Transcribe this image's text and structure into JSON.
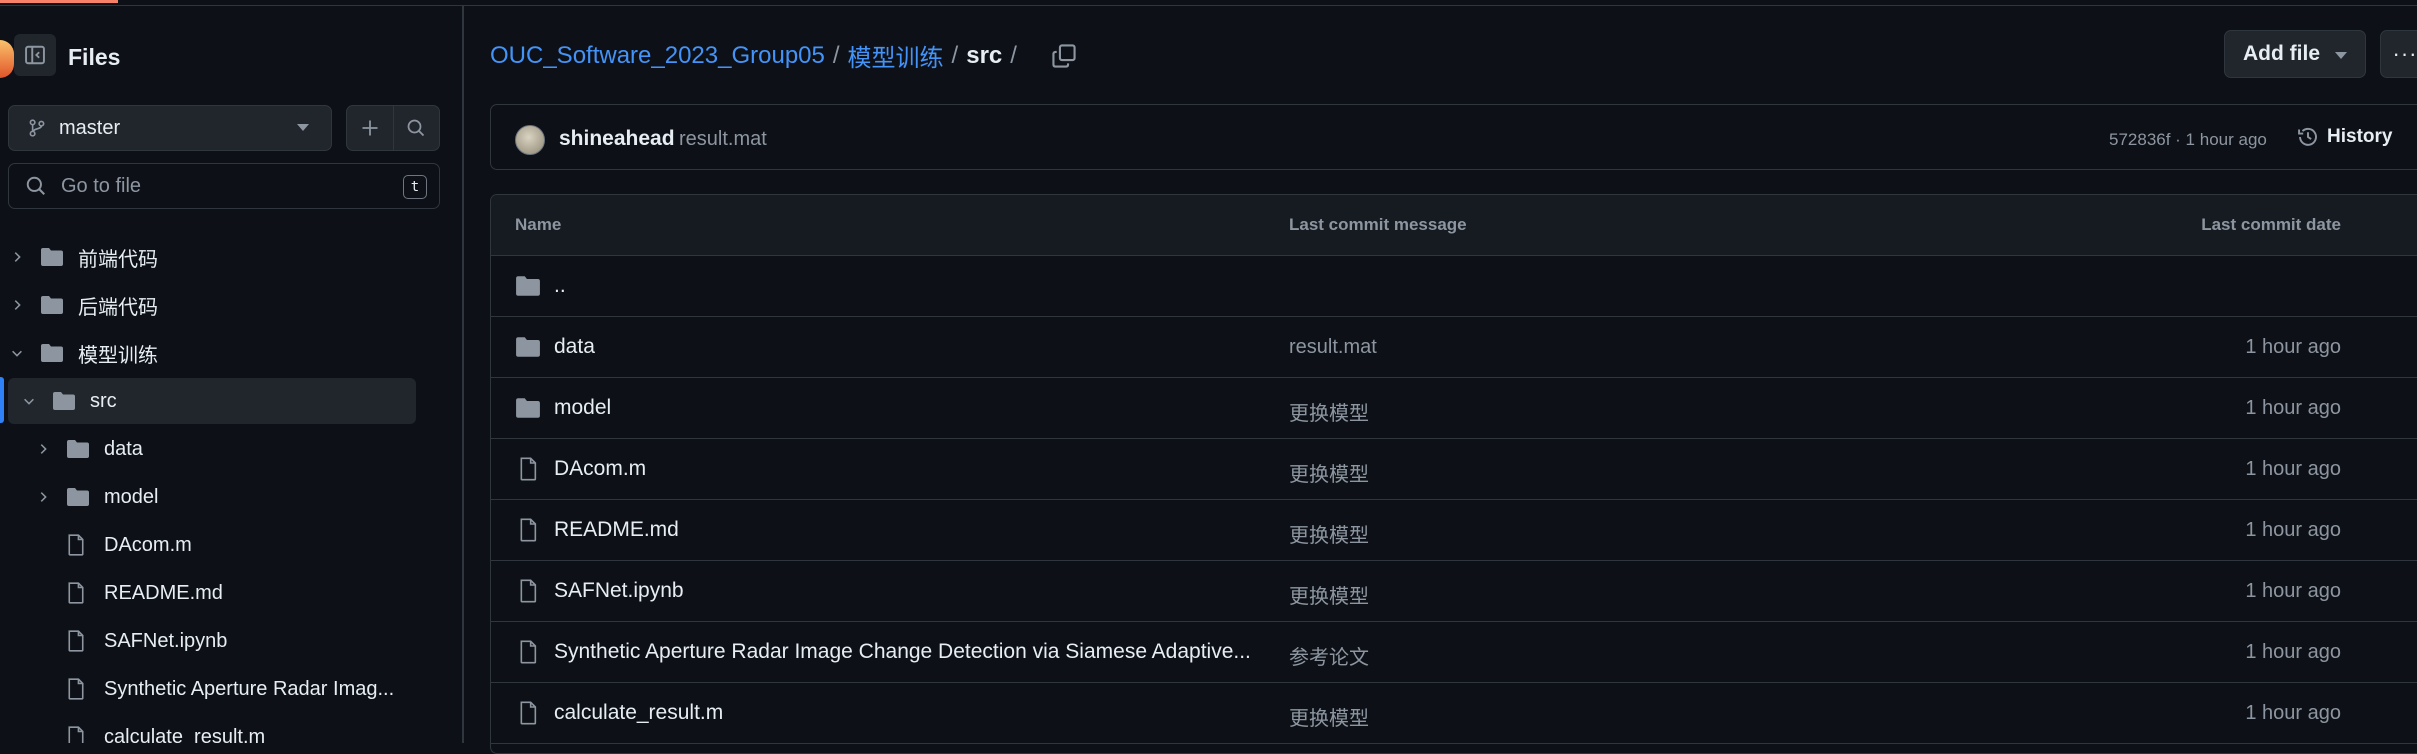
{
  "sidebar": {
    "title": "Files",
    "branch": "master",
    "goto_placeholder": "Go to file",
    "goto_shortcut": "t",
    "tree": [
      {
        "label": "前端代码",
        "type": "folder",
        "expanded": false
      },
      {
        "label": "后端代码",
        "type": "folder",
        "expanded": false
      },
      {
        "label": "模型训练",
        "type": "folder",
        "expanded": true
      },
      {
        "label": "src",
        "type": "folder",
        "expanded": true,
        "selected": true
      },
      {
        "label": "data",
        "type": "folder",
        "expanded": false
      },
      {
        "label": "model",
        "type": "folder",
        "expanded": false
      },
      {
        "label": "DAcom.m",
        "type": "file"
      },
      {
        "label": "README.md",
        "type": "file"
      },
      {
        "label": "SAFNet.ipynb",
        "type": "file"
      },
      {
        "label": "Synthetic Aperture Radar Imag...",
        "type": "file"
      },
      {
        "label": "calculate_result.m",
        "type": "file"
      }
    ]
  },
  "breadcrumb": {
    "repo": "OUC_Software_2023_Group05",
    "folder": "模型训练",
    "current": "src",
    "sep": "/"
  },
  "toolbar": {
    "add_file": "Add file",
    "more": "···"
  },
  "commit": {
    "author": "shineahead",
    "message": "result.mat",
    "meta": "572836f · 1 hour ago",
    "history": "History"
  },
  "table": {
    "headers": {
      "name": "Name",
      "message": "Last commit message",
      "date": "Last commit date"
    },
    "parent": "..",
    "rows": [
      {
        "name": "data",
        "type": "folder",
        "message": "result.mat",
        "date": "1 hour ago"
      },
      {
        "name": "model",
        "type": "folder",
        "message": "更换模型",
        "date": "1 hour ago"
      },
      {
        "name": "DAcom.m",
        "type": "file",
        "message": "更换模型",
        "date": "1 hour ago"
      },
      {
        "name": "README.md",
        "type": "file",
        "message": "更换模型",
        "date": "1 hour ago"
      },
      {
        "name": "SAFNet.ipynb",
        "type": "file",
        "message": "更换模型",
        "date": "1 hour ago"
      },
      {
        "name": "Synthetic Aperture Radar Image Change Detection via Siamese Adaptive...",
        "type": "file",
        "message": "参考论文",
        "date": "1 hour ago"
      },
      {
        "name": "calculate_result.m",
        "type": "file",
        "message": "更换模型",
        "date": "1 hour ago"
      }
    ]
  },
  "colors": {
    "link": "#4493f8",
    "accent": "#f78166",
    "muted": "#8d96a0",
    "folder": "#8d96a0"
  }
}
